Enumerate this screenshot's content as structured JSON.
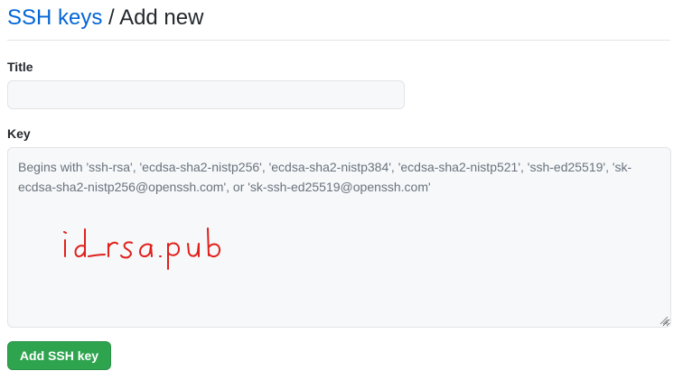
{
  "breadcrumb": {
    "parent": "SSH keys",
    "separator": "/",
    "current": "Add new"
  },
  "form": {
    "title_label": "Title",
    "title_value": "",
    "key_label": "Key",
    "key_placeholder": "Begins with 'ssh-rsa', 'ecdsa-sha2-nistp256', 'ecdsa-sha2-nistp384', 'ecdsa-sha2-nistp521', 'ssh-ed25519', 'sk-ecdsa-sha2-nistp256@openssh.com', or 'sk-ssh-ed25519@openssh.com'",
    "submit_label": "Add SSH key"
  },
  "annotation": {
    "handwritten_text": "id_rsa.pub",
    "color": "#e0201b"
  },
  "colors": {
    "link": "#0366d6",
    "button_green": "#2ea44f",
    "input_bg": "#f6f8fa",
    "border": "#e1e4e8"
  }
}
